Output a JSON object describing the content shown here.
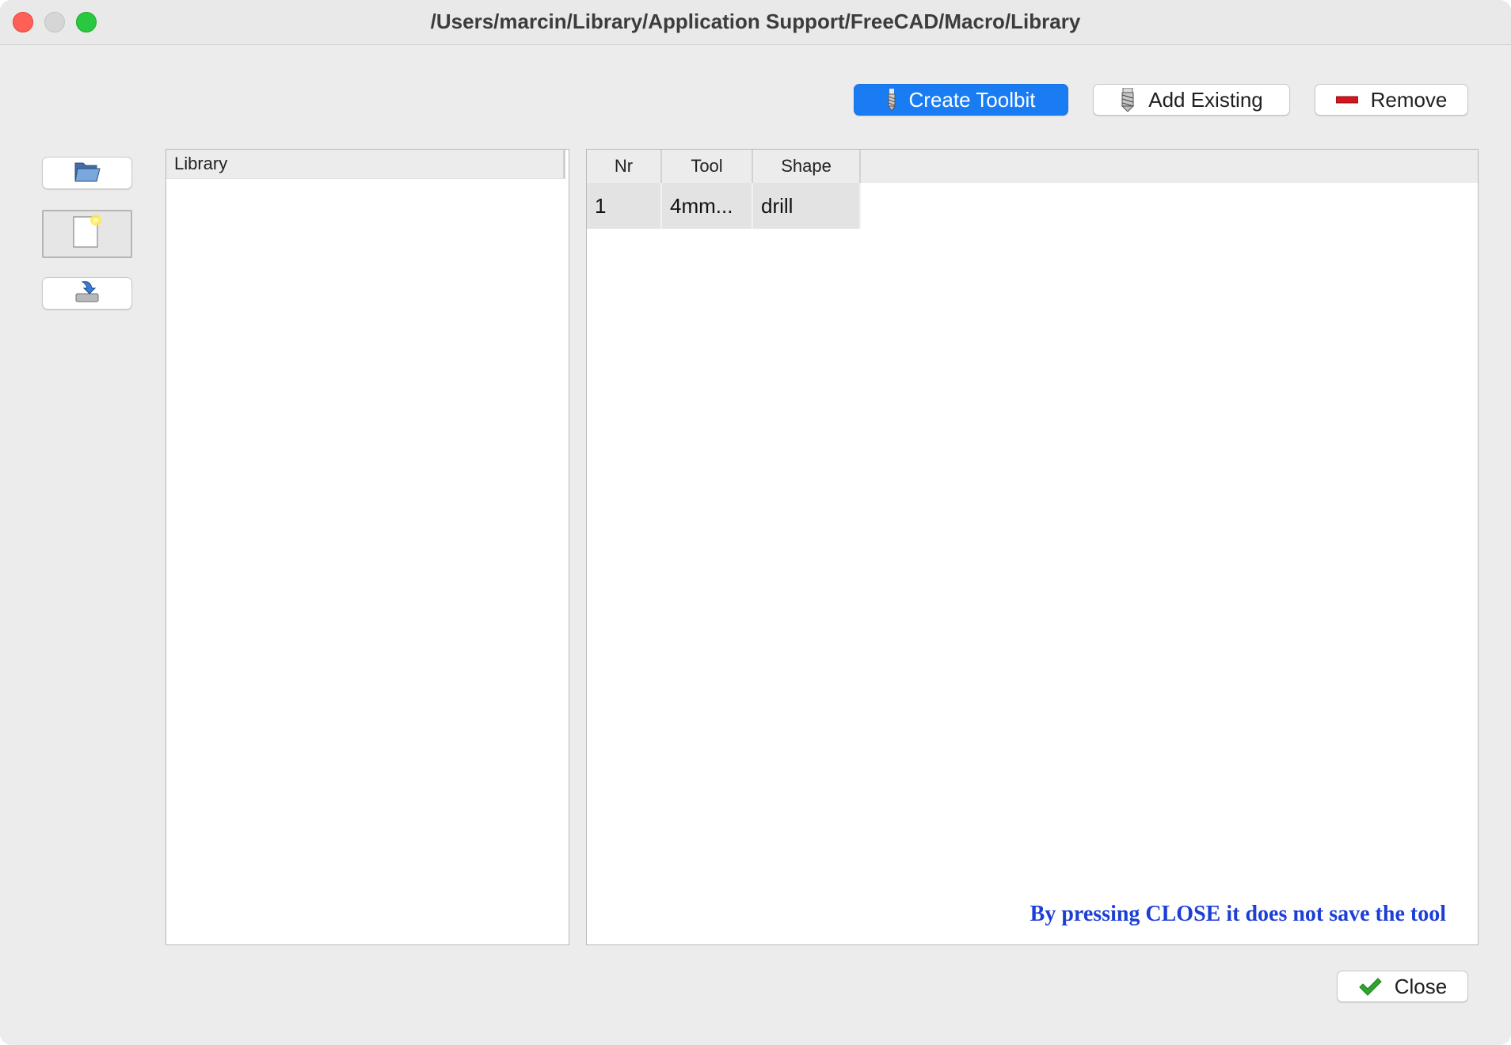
{
  "window": {
    "title": "/Users/marcin/Library/Application Support/FreeCAD/Macro/Library"
  },
  "toolbar": {
    "create_toolbit_label": "Create Toolbit",
    "add_existing_label": "Add Existing",
    "remove_label": "Remove"
  },
  "side_buttons": [
    {
      "icon": "open-folder-icon"
    },
    {
      "icon": "new-document-icon"
    },
    {
      "icon": "save-icon"
    }
  ],
  "library_panel": {
    "header": "Library"
  },
  "tool_table": {
    "columns": [
      "Nr",
      "Tool",
      "Shape"
    ],
    "rows": [
      [
        "1",
        "4mm...",
        "drill"
      ]
    ]
  },
  "note": "By pressing CLOSE it does not save the tool",
  "footer": {
    "close_label": "Close"
  },
  "colors": {
    "accent": "#1a7cf3",
    "note_text": "#1d3fd6",
    "close_red": "#fe5f57",
    "maximize_green": "#28c840"
  }
}
